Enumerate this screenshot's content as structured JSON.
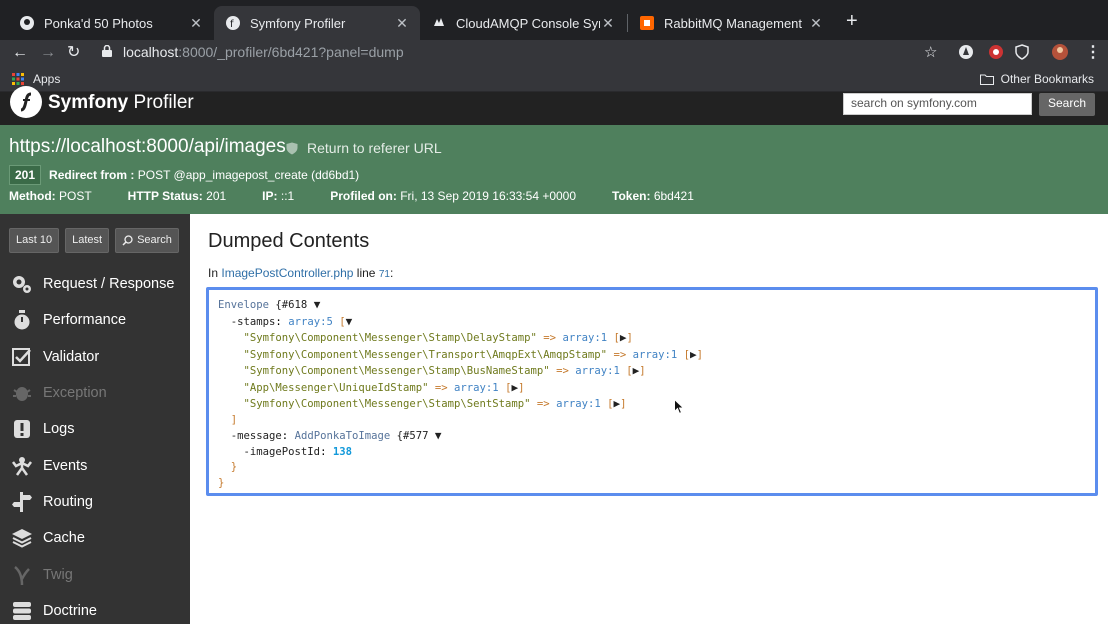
{
  "browser": {
    "tabs": [
      {
        "label": "Ponka'd 50 Photos"
      },
      {
        "label": "Symfony Profiler"
      },
      {
        "label": "CloudAMQP Console Symfony"
      },
      {
        "label": "RabbitMQ Management"
      }
    ],
    "url_host": "localhost",
    "url_path": ":8000/_profiler/6bd421?panel=dump",
    "bookmarks": {
      "apps": "Apps",
      "other": "Other Bookmarks"
    }
  },
  "header": {
    "brand_bold": "Symfony",
    "brand_rest": " Profiler",
    "search_placeholder": "search on symfony.com",
    "search_button": "Search"
  },
  "summary": {
    "url": "https://localhost:8000/api/images",
    "return_link": "Return to referer URL",
    "status_code": "201",
    "redirect_label": "Redirect from :",
    "redirect_value": "POST @app_imagepost_create (dd6bd1)",
    "method_label": "Method:",
    "method": "POST",
    "http_status_label": "HTTP Status:",
    "http_status": "201",
    "ip_label": "IP:",
    "ip": "::1",
    "profiled_label": "Profiled on:",
    "profiled": "Fri, 13 Sep 2019 16:33:54 +0000",
    "token_label": "Token:",
    "token": "6bd421"
  },
  "sidebar": {
    "buttons": {
      "last10": "Last 10",
      "latest": "Latest",
      "search": "Search"
    },
    "items": [
      {
        "label": "Request / Response",
        "icon": "gears-icon"
      },
      {
        "label": "Performance",
        "icon": "stopwatch-icon"
      },
      {
        "label": "Validator",
        "icon": "checkbox-icon"
      },
      {
        "label": "Exception",
        "icon": "bug-icon"
      },
      {
        "label": "Logs",
        "icon": "logs-icon"
      },
      {
        "label": "Events",
        "icon": "events-icon"
      },
      {
        "label": "Routing",
        "icon": "signpost-icon"
      },
      {
        "label": "Cache",
        "icon": "layers-icon"
      },
      {
        "label": "Twig",
        "icon": "twig-icon"
      },
      {
        "label": "Doctrine",
        "icon": "database-icon"
      }
    ]
  },
  "main": {
    "title": "Dumped Contents",
    "in_label": "In",
    "file": "ImagePostController.php",
    "line_label": "line",
    "line": "71",
    "colon": ":"
  },
  "dump": {
    "class": "Envelope",
    "class_id": "{#618",
    "stamps_key": "-stamps",
    "stamps_type": "array:5",
    "stamps": [
      {
        "name": "\"Symfony\\Component\\Messenger\\Stamp\\DelayStamp\"",
        "type": "array:1"
      },
      {
        "name": "\"Symfony\\Component\\Messenger\\Transport\\AmqpExt\\AmqpStamp\"",
        "type": "array:1"
      },
      {
        "name": "\"Symfony\\Component\\Messenger\\Stamp\\BusNameStamp\"",
        "type": "array:1"
      },
      {
        "name": "\"App\\Messenger\\UniqueIdStamp\"",
        "type": "array:1"
      },
      {
        "name": "\"Symfony\\Component\\Messenger\\Stamp\\SentStamp\"",
        "type": "array:1"
      }
    ],
    "message_key": "-message",
    "message_class": "AddPonkaToImage",
    "message_id": "{#577",
    "prop_key": "-imagePostId",
    "prop_value": "138"
  }
}
